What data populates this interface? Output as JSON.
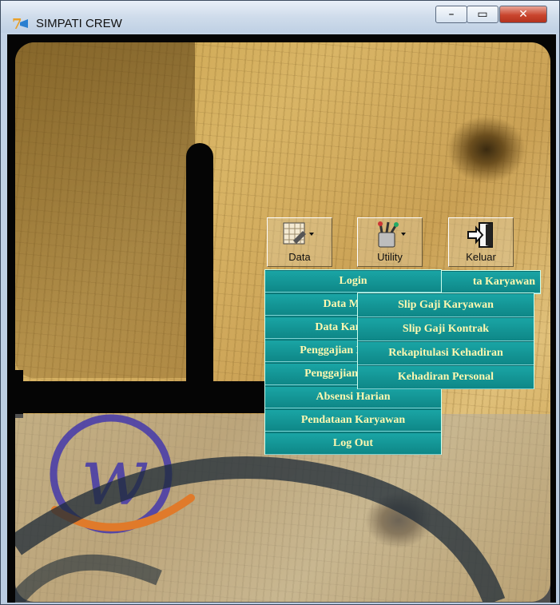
{
  "window": {
    "title": "SIMPATI CREW",
    "controls": {
      "minimize": "–",
      "maximize": "▭",
      "close": "✕"
    }
  },
  "toolbar": {
    "items": [
      {
        "label": "Data",
        "icon": "data-icon"
      },
      {
        "label": "Utility",
        "icon": "utility-icon"
      },
      {
        "label": "Keluar",
        "icon": "exit-door-icon"
      }
    ]
  },
  "data_menu": {
    "items": [
      "Login",
      "Data Master",
      "Data Karyawan",
      "Penggajian Karyawan",
      "Penggajian Kontrak",
      "Absensi Harian",
      "Pendataan Karyawan",
      "Log Out"
    ]
  },
  "utility_menu": {
    "header_partial": "ta Karyawan",
    "items": [
      "Slip Gaji Karyawan",
      "Slip Gaji Kontrak",
      "Rekapitulasi Kehadiran",
      "Kehadiran Personal"
    ]
  },
  "colors": {
    "menu_bg": "#0f8c8c",
    "menu_text": "#fff8b0",
    "frame": "#c3d3e6",
    "logo_purple": "#4a3ea8",
    "logo_orange": "#e07a2a"
  }
}
